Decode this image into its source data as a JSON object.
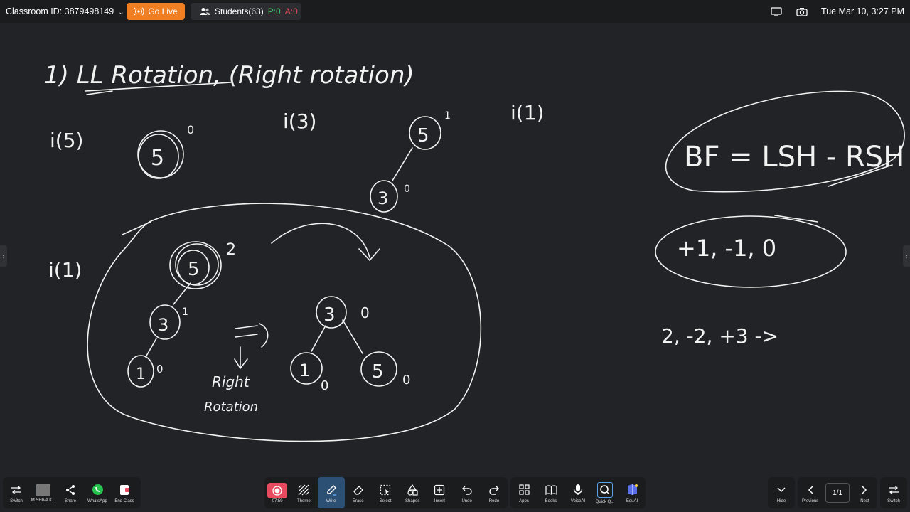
{
  "topbar": {
    "class_id": "Classroom ID: 3879498149",
    "go_live": "Go Live",
    "students_label": "Students(63)",
    "p_count": "P:0",
    "a_count": "A:0",
    "datetime": "Tue Mar 10, 3:27 PM"
  },
  "board": {
    "title": "1) LL Rotation, (Right rotation)",
    "bf_formula": "BF = LSH - RSH",
    "bf_values": "+1, -1, 0",
    "bf_invalid": "2, -2, +3 ->",
    "insert_labels": [
      "i(5)",
      "i(3)",
      "i(1)",
      "i(1)"
    ],
    "nodes": {
      "n5": "5",
      "n5_bf": "0",
      "tree2_root": "5",
      "tree2_root_bf": "1",
      "tree2_child": "3",
      "tree2_child_bf": "0",
      "tree3_root": "5",
      "tree3_root_bf": "2",
      "tree3_mid": "3",
      "tree3_mid_bf": "1",
      "tree3_leaf": "1",
      "tree3_leaf_bf": "0",
      "res_root": "3",
      "res_root_bf": "0",
      "res_left": "1",
      "res_left_bf": "0",
      "res_right": "5",
      "res_right_bf": "0"
    },
    "arrow_note": "=>",
    "rotation_note_1": "Right",
    "rotation_note_2": "Rotation"
  },
  "toolbar": {
    "left": [
      {
        "label": "Switch",
        "icon": "switch-icon"
      },
      {
        "label": "M SHIVA K...",
        "icon": "avatar"
      },
      {
        "label": "Share",
        "icon": "share-icon"
      },
      {
        "label": "WhatsApp",
        "icon": "whatsapp-icon"
      },
      {
        "label": "End Class",
        "icon": "end-class-icon"
      }
    ],
    "record_time": "07:59",
    "tools": [
      "Theme",
      "Write",
      "Erase",
      "Select",
      "Shapes",
      "Insert",
      "Undo",
      "Redo"
    ],
    "apps": [
      "Apps",
      "Books",
      "VoiceAI",
      "Quick Q...",
      "EduAI"
    ],
    "right": {
      "hide": "Hide",
      "previous": "Previous",
      "page": "1/1",
      "next": "Next",
      "switch": "Switch"
    }
  },
  "colors": {
    "background": "#212326",
    "bar": "#1b1c1e",
    "accent": "#f07f23",
    "active_tool": "#2c4f74",
    "record": "#e84a5f"
  }
}
